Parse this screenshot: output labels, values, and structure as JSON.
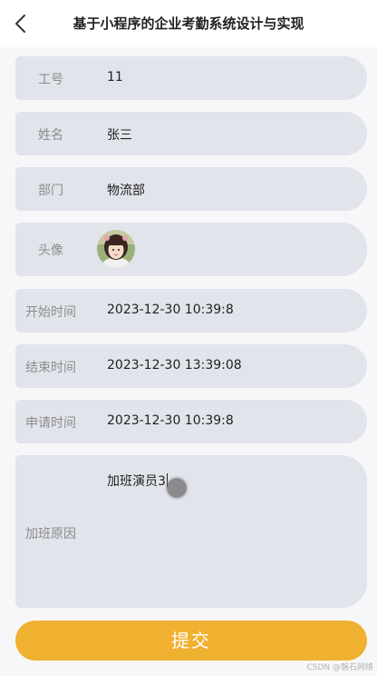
{
  "nav": {
    "title": "基于小程序的企业考勤系统设计与实现",
    "back_icon": "chevron-left-icon"
  },
  "form": {
    "employee_id": {
      "label": "工号",
      "value": "11"
    },
    "name": {
      "label": "姓名",
      "value": "张三"
    },
    "department": {
      "label": "部门",
      "value": "物流部"
    },
    "avatar": {
      "label": "头像"
    },
    "start_time": {
      "label": "开始时间",
      "value": "2023-12-30 10:39:8"
    },
    "end_time": {
      "label": "结束时间",
      "value": "2023-12-30 13:39:08"
    },
    "apply_time": {
      "label": "申请时间",
      "value": "2023-12-30 10:39:8"
    },
    "reason": {
      "label": "加班原因",
      "value": "加班演员3"
    }
  },
  "submit_label": "提交",
  "watermark": "CSDN @磐石网络",
  "colors": {
    "field_bg": "#e2e4ec",
    "accent": "#f0b030",
    "label": "#8c8c8c"
  }
}
